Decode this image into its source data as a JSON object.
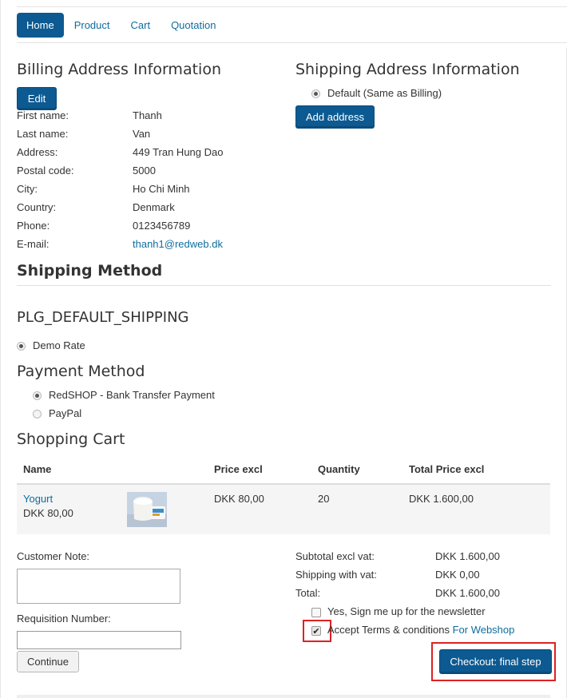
{
  "nav": {
    "tabs": [
      {
        "label": "Home",
        "active": true
      },
      {
        "label": "Product",
        "active": false
      },
      {
        "label": "Cart",
        "active": false
      },
      {
        "label": "Quotation",
        "active": false
      }
    ]
  },
  "billing": {
    "title": "Billing Address Information",
    "edit_label": "Edit",
    "fields": [
      {
        "label": "First name:",
        "value": "Thanh"
      },
      {
        "label": "Last name:",
        "value": "Van"
      },
      {
        "label": "Address:",
        "value": "449 Tran Hung Dao"
      },
      {
        "label": "Postal code:",
        "value": "5000"
      },
      {
        "label": "City:",
        "value": "Ho Chi Minh"
      },
      {
        "label": "Country:",
        "value": "Denmark"
      },
      {
        "label": "Phone:",
        "value": "0123456789"
      },
      {
        "label": "E-mail:",
        "value": "thanh1@redweb.dk"
      }
    ]
  },
  "shipping_address": {
    "title": "Shipping Address Information",
    "default_option": "Default (Same as Billing)",
    "add_label": "Add address"
  },
  "shipping_method": {
    "title": "Shipping Method",
    "plugin_title": "PLG_DEFAULT_SHIPPING",
    "rate_label": "Demo Rate"
  },
  "payment_method": {
    "title": "Payment Method",
    "options": [
      {
        "label": "RedSHOP - Bank Transfer Payment",
        "selected": true
      },
      {
        "label": "PayPal",
        "selected": false
      }
    ]
  },
  "cart": {
    "title": "Shopping Cart",
    "headers": {
      "name": "Name",
      "price": "Price excl",
      "quantity": "Quantity",
      "total": "Total Price excl"
    },
    "items": [
      {
        "name": "Yogurt",
        "unit_price": "DKK 80,00",
        "price_excl": "DKK 80,00",
        "quantity": "20",
        "total": "DKK 1.600,00"
      }
    ]
  },
  "form": {
    "customer_note_label": "Customer Note:",
    "requisition_label": "Requisition Number:",
    "continue_label": "Continue"
  },
  "summary": {
    "subtotal_label": "Subtotal excl vat:",
    "subtotal_value": "DKK 1.600,00",
    "shipping_label": "Shipping with vat:",
    "shipping_value": "DKK 0,00",
    "total_label": "Total:",
    "total_value": "DKK 1.600,00",
    "newsletter_label": "Yes, Sign me up for the newsletter",
    "terms_label": "Accept Terms & conditions",
    "terms_link": "For Webshop",
    "checkout_label": "Checkout: final step"
  },
  "colors": {
    "accent": "#0c5a91",
    "link": "#0f6d9e",
    "highlight": "#dd2222"
  }
}
